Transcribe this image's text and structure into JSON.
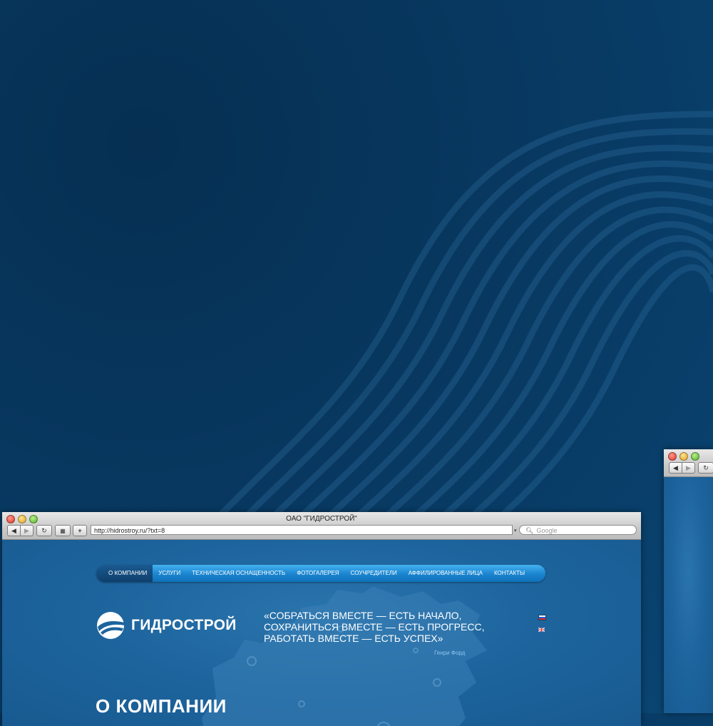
{
  "window": {
    "title": "ОАО \"ГИДРОСТРОЙ\"",
    "url": "http://hidrostroy.ru/?txt=8",
    "search_placeholder": "Google",
    "add_label": "+"
  },
  "menu": {
    "items": [
      {
        "label": "О КОМПАНИИ",
        "active": true
      },
      {
        "label": "УСЛУГИ",
        "active": false
      },
      {
        "label": "ТЕХНИЧЕСКАЯ ОСНАЩЕННОСТЬ",
        "active": false
      },
      {
        "label": "ФОТОГАЛЕРЕЯ",
        "active": false
      },
      {
        "label": "СОУЧРЕДИТЕЛИ",
        "active": false
      },
      {
        "label": "АФФИЛИРОВАННЫЕ ЛИЦА",
        "active": false
      },
      {
        "label": "КОНТАКТЫ",
        "active": false
      }
    ]
  },
  "brand": {
    "name": "ГИДРОСТРОЙ"
  },
  "quote": {
    "lines": [
      "«СОБРАТЬСЯ ВМЕСТЕ — ЕСТЬ НАЧАЛО,",
      "СОХРАНИТЬСЯ ВМЕСТЕ — ЕСТЬ ПРОГРЕСС,",
      "РАБОТАТЬ ВМЕСТЕ — ЕСТЬ УСПЕХ»"
    ],
    "author": "Генри Форд"
  },
  "page": {
    "heading": "О КОМПАНИИ"
  },
  "colors": {
    "background": "#083a63",
    "menu_accent": "#1a84cf",
    "menu_active": "#0e3f6d",
    "page_bg": "#1d649d"
  }
}
